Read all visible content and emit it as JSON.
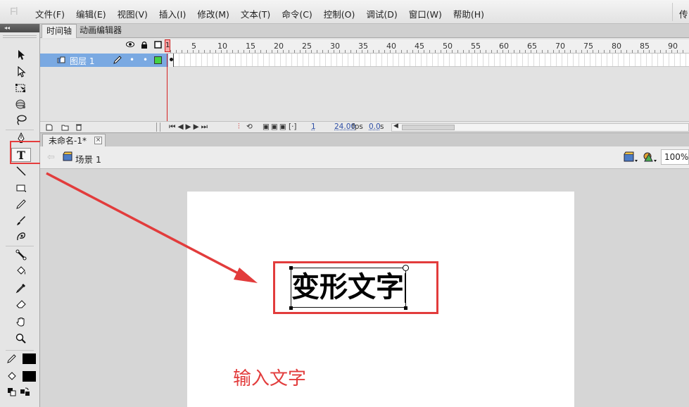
{
  "app": {
    "logo": "Fl"
  },
  "menu": {
    "items": [
      "文件(F)",
      "编辑(E)",
      "视图(V)",
      "插入(I)",
      "修改(M)",
      "文本(T)",
      "命令(C)",
      "控制(O)",
      "调试(D)",
      "窗口(W)",
      "帮助(H)"
    ],
    "right_text": "传"
  },
  "tools": {
    "collapse_glyph": "◂◂",
    "items": [
      "selection-tool",
      "subselection-tool",
      "free-transform-tool",
      "3d-rotation-tool",
      "lasso-tool",
      "pen-tool",
      "text-tool",
      "line-tool",
      "rectangle-tool",
      "pencil-tool",
      "brush-tool",
      "deco-tool",
      "bone-tool",
      "paint-bucket-tool",
      "eyedropper-tool",
      "eraser-tool",
      "hand-tool",
      "zoom-tool"
    ],
    "stroke_color": "#000000",
    "fill_color": "#000000"
  },
  "timeline": {
    "tabs": [
      "时间轴",
      "动画编辑器"
    ],
    "active_tab": "时间轴",
    "ruler_labels": [
      "1",
      "5",
      "10",
      "15",
      "20",
      "25",
      "30",
      "35",
      "40",
      "45",
      "50",
      "55",
      "60",
      "65",
      "70",
      "75",
      "80",
      "85",
      "90"
    ],
    "current_frame": "1",
    "layers": [
      {
        "name": "图层 1",
        "color": "#44d244"
      }
    ],
    "footer": {
      "frame": "1",
      "fps": "24.00",
      "fps_unit": "fps",
      "time": "0.0",
      "time_unit": "s"
    }
  },
  "document": {
    "tab_title": "未命名-1*",
    "close_glyph": "×",
    "scene": "场景 1",
    "zoom": "100%"
  },
  "stage": {
    "text": "变形文字",
    "annotation": "输入文字",
    "highlight_color": "#e23c3c"
  }
}
